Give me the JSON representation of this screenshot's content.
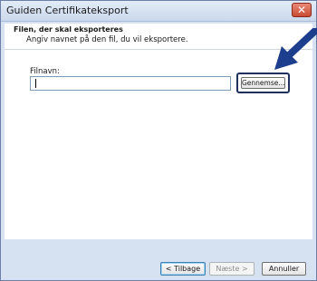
{
  "window": {
    "title": "Guiden Certifikateksport",
    "close_symbol": "✕"
  },
  "header": {
    "title": "Filen, der skal eksporteres",
    "subtitle": "Angiv navnet på den fil, du vil eksportere."
  },
  "form": {
    "filename_label": "Filnavn:",
    "filename_value": "",
    "browse_label": "Gennemse..."
  },
  "annotation": {
    "arrow_color": "#1d3e8c",
    "highlight_color": "#20305c"
  },
  "buttons": {
    "back": "< Tilbage",
    "next": "Næste >",
    "cancel": "Annuller"
  }
}
